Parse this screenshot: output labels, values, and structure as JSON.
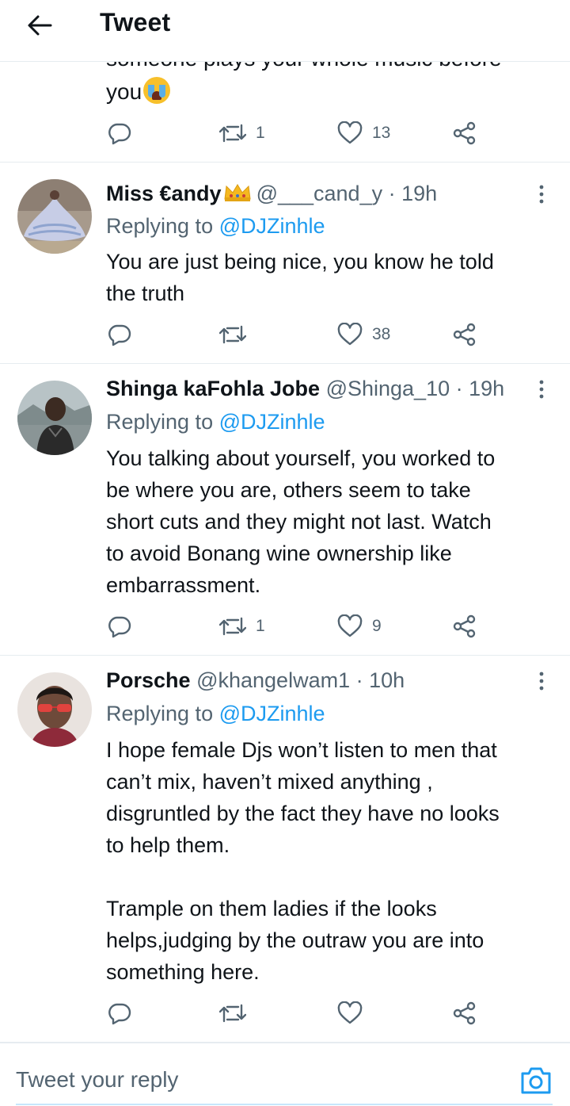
{
  "header": {
    "title": "Tweet"
  },
  "prev_tweet": {
    "text_line1": "someone plays your whole music before",
    "text_line2": "you",
    "emoji": "loudly-crying-face",
    "retweets": "1",
    "likes": "13"
  },
  "replies": [
    {
      "name": "Miss €andy",
      "name_emoji": "crown",
      "handle": "@___cand_y",
      "time": "· 19h",
      "replying_label": "Replying to",
      "replying_to": "@DJZinhle",
      "lines": [
        "You are just being nice, you know he told",
        "the truth"
      ],
      "retweets": "",
      "likes": "38"
    },
    {
      "name": "Shinga kaFohla Jobe",
      "handle": "@Shinga_10",
      "time": "· 19h",
      "replying_label": "Replying to",
      "replying_to": "@DJZinhle",
      "lines": [
        "You talking about yourself, you worked to",
        "be where you are, others seem to take",
        "short cuts and they might not last. Watch",
        "to avoid Bonang wine ownership like",
        "embarrassment."
      ],
      "retweets": "1",
      "likes": "9"
    },
    {
      "name": "Porsche",
      "handle": "@khangelwam1",
      "time": "· 10h",
      "replying_label": "Replying to",
      "replying_to": "@DJZinhle",
      "lines": [
        "I hope female Djs won’t listen to men that",
        "can’t mix, haven’t mixed anything ,",
        "disgruntled by the fact they have no looks",
        "to help them.",
        "",
        "Trample on them ladies if the looks",
        "helps,judging by the outraw you are into",
        "something here."
      ],
      "retweets": "",
      "likes": ""
    }
  ],
  "compose": {
    "placeholder": "Tweet your reply"
  },
  "colors": {
    "accent": "#1d9bf0",
    "muted": "#536471",
    "divider": "#e6ecf0",
    "text": "#0f1419"
  }
}
